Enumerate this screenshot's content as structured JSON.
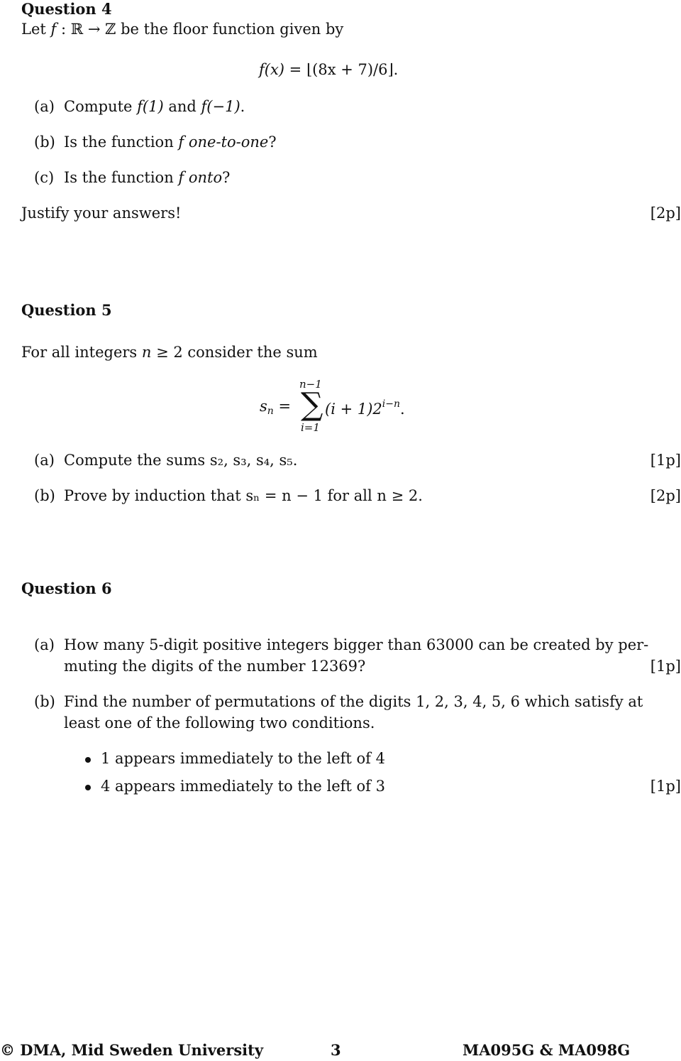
{
  "q4": {
    "title": "Question 4",
    "intro_pre": "Let ",
    "intro_f": "f",
    "intro_mid": " : ℝ → ℤ be the floor function given by",
    "formula_lhs": "f(x) = ",
    "formula_rhs": "⌊(8x + 7)/6⌋.",
    "items": [
      {
        "label": "(a)",
        "text_pre": "Compute ",
        "math": "f(1)",
        "text_mid": " and ",
        "math2": "f(−1)",
        "text_post": "."
      },
      {
        "label": "(b)",
        "text_pre": "Is the function ",
        "math": "f",
        "emph": "one-to-one",
        "text_post": "?"
      },
      {
        "label": "(c)",
        "text_pre": "Is the function ",
        "math": "f",
        "emph": "onto",
        "text_post": "?"
      }
    ],
    "closing": "Justify your answers!",
    "points": "[2p]"
  },
  "q5": {
    "title": "Question 5",
    "intro_pre": "For all integers ",
    "intro_n": "n",
    "intro_post": " ≥ 2 consider the sum",
    "formula_lhs_s": "s",
    "formula_lhs_sub": "n",
    "formula_eq": " = ",
    "sum_upper": "n−1",
    "sum_lower": "i=1",
    "formula_body": "(i + 1)2",
    "formula_exp": "i−n",
    "formula_end": ".",
    "items": [
      {
        "label": "(a)",
        "text": "Compute the sums s₂, s₃, s₄, s₅.",
        "points": "[1p]"
      },
      {
        "label": "(b)",
        "text": "Prove by induction that sₙ = n − 1 for all n ≥ 2.",
        "points": "[2p]"
      }
    ]
  },
  "q6": {
    "title": "Question 6",
    "items": [
      {
        "label": "(a)",
        "line1": "How many 5-digit positive integers bigger than 63000 can be created by per-",
        "line2": "muting the digits of the number 12369?",
        "points": "[1p]"
      },
      {
        "label": "(b)",
        "line1": "Find the number of permutations of the digits 1, 2, 3, 4, 5, 6 which satisfy at",
        "line2": "least one of the following two conditions."
      }
    ],
    "bullets": [
      "1 appears immediately to the left of 4",
      "4 appears immediately to the left of 3"
    ],
    "bullets_points": "[1p]"
  },
  "footer": {
    "copyright": "© DMA, Mid Sweden University",
    "page_number": "3",
    "course": "MA095G & MA098G"
  }
}
